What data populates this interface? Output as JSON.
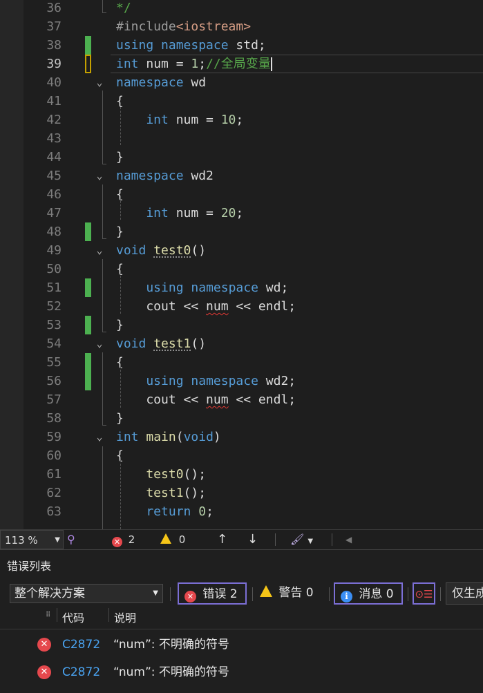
{
  "editor": {
    "lines": [
      {
        "no": "36",
        "change": "none",
        "fold": "",
        "tokens": [
          {
            "t": "*/",
            "c": "cmt"
          }
        ]
      },
      {
        "no": "37",
        "change": "none",
        "fold": "",
        "tokens": [
          {
            "t": "#include",
            "c": "pp"
          },
          {
            "t": "<iostream>",
            "c": "str"
          }
        ]
      },
      {
        "no": "38",
        "change": "saved",
        "fold": "",
        "tokens": [
          {
            "t": "using",
            "c": "kw"
          },
          {
            "t": " ",
            "c": "ident"
          },
          {
            "t": "namespace",
            "c": "kw"
          },
          {
            "t": " std;",
            "c": "ident"
          }
        ]
      },
      {
        "no": "39",
        "change": "unsaved",
        "fold": "",
        "current": true,
        "tokens": [
          {
            "t": "int",
            "c": "kw"
          },
          {
            "t": " num = ",
            "c": "ident"
          },
          {
            "t": "1",
            "c": "num"
          },
          {
            "t": ";",
            "c": "ident"
          },
          {
            "t": "//全局变量",
            "c": "cmt"
          }
        ]
      },
      {
        "no": "40",
        "change": "none",
        "fold": "v",
        "tokens": [
          {
            "t": "namespace",
            "c": "kw"
          },
          {
            "t": " wd",
            "c": "ident"
          }
        ]
      },
      {
        "no": "41",
        "change": "none",
        "fold": "",
        "tokens": [
          {
            "t": "{",
            "c": "ident"
          }
        ]
      },
      {
        "no": "42",
        "change": "none",
        "fold": "",
        "tokens": [
          {
            "t": "    int",
            "c": "kw"
          },
          {
            "t": " num = ",
            "c": "ident"
          },
          {
            "t": "10",
            "c": "num"
          },
          {
            "t": ";",
            "c": "ident"
          }
        ]
      },
      {
        "no": "43",
        "change": "none",
        "fold": "",
        "tokens": []
      },
      {
        "no": "44",
        "change": "none",
        "fold": "",
        "tokens": [
          {
            "t": "}",
            "c": "ident"
          }
        ]
      },
      {
        "no": "45",
        "change": "none",
        "fold": "v",
        "tokens": [
          {
            "t": "namespace",
            "c": "kw"
          },
          {
            "t": " wd2",
            "c": "ident"
          }
        ]
      },
      {
        "no": "46",
        "change": "none",
        "fold": "",
        "tokens": [
          {
            "t": "{",
            "c": "ident"
          }
        ]
      },
      {
        "no": "47",
        "change": "none",
        "fold": "",
        "tokens": [
          {
            "t": "    int",
            "c": "kw"
          },
          {
            "t": " num = ",
            "c": "ident"
          },
          {
            "t": "20",
            "c": "num"
          },
          {
            "t": ";",
            "c": "ident"
          }
        ]
      },
      {
        "no": "48",
        "change": "saved",
        "fold": "",
        "tokens": [
          {
            "t": "}",
            "c": "ident"
          }
        ]
      },
      {
        "no": "49",
        "change": "none",
        "fold": "v",
        "tokens": [
          {
            "t": "void",
            "c": "kw"
          },
          {
            "t": " ",
            "c": "ident"
          },
          {
            "t": "test0",
            "c": "fn",
            "u": "dotted"
          },
          {
            "t": "()",
            "c": "ident"
          }
        ]
      },
      {
        "no": "50",
        "change": "none",
        "fold": "",
        "tokens": [
          {
            "t": "{",
            "c": "ident"
          }
        ]
      },
      {
        "no": "51",
        "change": "saved",
        "fold": "",
        "tokens": [
          {
            "t": "    using",
            "c": "kw"
          },
          {
            "t": " ",
            "c": "ident"
          },
          {
            "t": "namespace",
            "c": "kw"
          },
          {
            "t": " wd;",
            "c": "ident"
          }
        ]
      },
      {
        "no": "52",
        "change": "none",
        "fold": "",
        "tokens": [
          {
            "t": "    cout << ",
            "c": "ident"
          },
          {
            "t": "num",
            "c": "ident",
            "u": "squig"
          },
          {
            "t": " << endl;",
            "c": "ident"
          }
        ]
      },
      {
        "no": "53",
        "change": "saved",
        "fold": "",
        "tokens": [
          {
            "t": "}",
            "c": "ident"
          }
        ]
      },
      {
        "no": "54",
        "change": "none",
        "fold": "v",
        "tokens": [
          {
            "t": "void",
            "c": "kw"
          },
          {
            "t": " ",
            "c": "ident"
          },
          {
            "t": "test1",
            "c": "fn",
            "u": "dotted"
          },
          {
            "t": "()",
            "c": "ident"
          }
        ]
      },
      {
        "no": "55",
        "change": "saved",
        "fold": "",
        "tokens": [
          {
            "t": "{",
            "c": "ident"
          }
        ]
      },
      {
        "no": "56",
        "change": "saved",
        "fold": "",
        "tokens": [
          {
            "t": "    using",
            "c": "kw"
          },
          {
            "t": " ",
            "c": "ident"
          },
          {
            "t": "namespace",
            "c": "kw"
          },
          {
            "t": " wd2;",
            "c": "ident"
          }
        ]
      },
      {
        "no": "57",
        "change": "none",
        "fold": "",
        "tokens": [
          {
            "t": "    cout << ",
            "c": "ident"
          },
          {
            "t": "num",
            "c": "ident",
            "u": "squig"
          },
          {
            "t": " << endl;",
            "c": "ident"
          }
        ]
      },
      {
        "no": "58",
        "change": "none",
        "fold": "",
        "tokens": [
          {
            "t": "}",
            "c": "ident"
          }
        ]
      },
      {
        "no": "59",
        "change": "none",
        "fold": "v",
        "tokens": [
          {
            "t": "int",
            "c": "kw"
          },
          {
            "t": " ",
            "c": "ident"
          },
          {
            "t": "main",
            "c": "fn"
          },
          {
            "t": "(",
            "c": "ident"
          },
          {
            "t": "void",
            "c": "kw"
          },
          {
            "t": ")",
            "c": "ident"
          }
        ]
      },
      {
        "no": "60",
        "change": "none",
        "fold": "",
        "tokens": [
          {
            "t": "{",
            "c": "ident"
          }
        ]
      },
      {
        "no": "61",
        "change": "none",
        "fold": "",
        "tokens": [
          {
            "t": "    test0",
            "c": "fn"
          },
          {
            "t": "();",
            "c": "ident"
          }
        ]
      },
      {
        "no": "62",
        "change": "none",
        "fold": "",
        "tokens": [
          {
            "t": "    test1",
            "c": "fn"
          },
          {
            "t": "();",
            "c": "ident"
          }
        ]
      },
      {
        "no": "63",
        "change": "none",
        "fold": "",
        "tokens": [
          {
            "t": "    return",
            "c": "kw"
          },
          {
            "t": " ",
            "c": "ident"
          },
          {
            "t": "0",
            "c": "num"
          },
          {
            "t": ";",
            "c": "ident"
          }
        ]
      }
    ]
  },
  "status": {
    "zoom": "113 %",
    "errors": "2",
    "warnings": "0"
  },
  "errorList": {
    "title": "错误列表",
    "scope": "整个解决方案",
    "errorsBtn": "错误 2",
    "warningsBtn": "警告 0",
    "messagesBtn": "消息 0",
    "buildFilter": "仅生成",
    "colCode": "代码",
    "colDesc": "说明",
    "rows": [
      {
        "code": "C2872",
        "desc": "“num”: 不明确的符号"
      },
      {
        "code": "C2872",
        "desc": "“num”: 不明确的符号"
      }
    ]
  },
  "colors": {
    "keyword": "#569cd6",
    "function": "#dcdcaa",
    "number": "#b5cea8",
    "comment": "#57a64a",
    "string": "#d69d85",
    "errorRed": "#e5484d",
    "changeGreen": "#4cb050",
    "filterBorder": "#7c6fd6"
  }
}
